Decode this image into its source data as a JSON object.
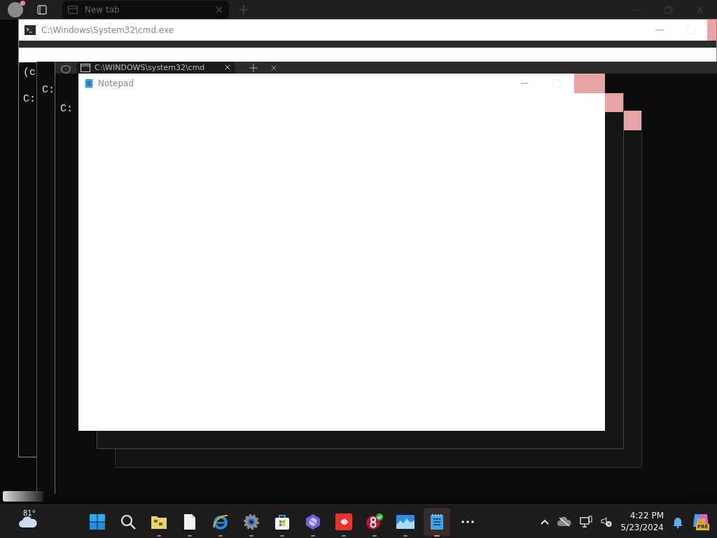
{
  "browser": {
    "tab": {
      "title": "New tab",
      "selected": true
    }
  },
  "cmd_window": {
    "title": "C:\\Windows\\System32\\cmd.exe",
    "lines": [
      "(c",
      "C:"
    ]
  },
  "cmd_window_2": {
    "lines": [
      "C:"
    ]
  },
  "terminal": {
    "tab": {
      "title": "C:\\WINDOWS\\system32\\cmd",
      "selected": true
    },
    "lines": [
      "C:"
    ]
  },
  "notepad": {
    "title": "Notepad"
  },
  "taskbar": {
    "weather": "81°",
    "apps": [
      {
        "kind": "start",
        "running": false,
        "selected": false
      },
      {
        "kind": "search",
        "running": false,
        "selected": false
      },
      {
        "kind": "explorer",
        "running": true,
        "selected": false
      },
      {
        "kind": "document",
        "running": true,
        "selected": false
      },
      {
        "kind": "browser",
        "running": true,
        "selected": false
      },
      {
        "kind": "settings",
        "running": true,
        "selected": false
      },
      {
        "kind": "store",
        "running": true,
        "selected": false
      },
      {
        "kind": "hexagon",
        "running": true,
        "selected": false
      },
      {
        "kind": "remote",
        "running": true,
        "selected": false
      },
      {
        "kind": "eight",
        "running": true,
        "selected": false
      },
      {
        "kind": "photos",
        "running": true,
        "selected": false
      },
      {
        "kind": "notepad",
        "running": true,
        "selected": true
      },
      {
        "kind": "more",
        "running": false,
        "selected": false
      }
    ],
    "time": "4:22 PM",
    "date": "5/23/2024",
    "copilot_badge": "PRE"
  }
}
